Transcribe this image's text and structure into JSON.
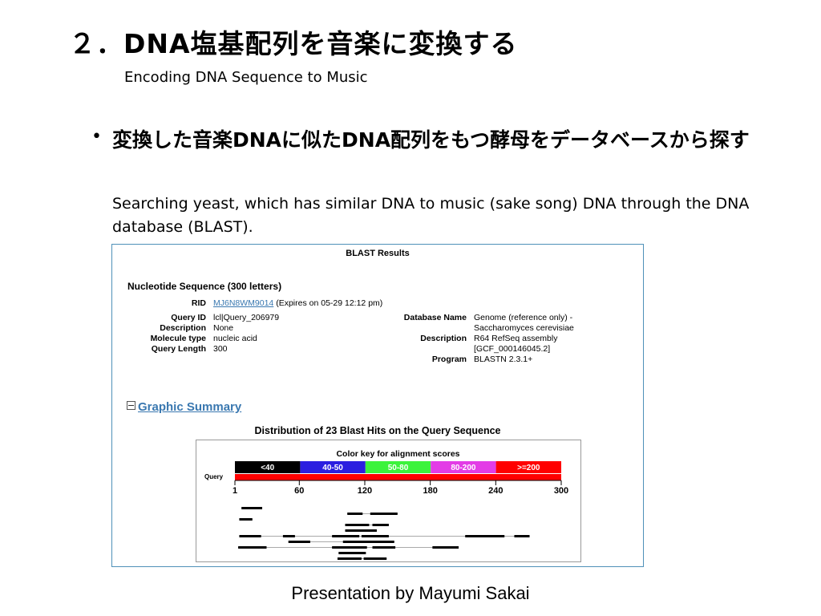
{
  "slide": {
    "title": "２．DNA塩基配列を音楽に変換する",
    "subtitle": "Encoding DNA Sequence to Music",
    "bullet_text": "変換した音楽DNAに似たDNA配列をもつ酵母をデータベースから探す",
    "bullet_sub": "Searching yeast, which has similar DNA to music (sake song) DNA through the DNA database (BLAST).",
    "footer": "Presentation by Mayumi Sakai"
  },
  "blast": {
    "header": "BLAST Results",
    "nucleotide_title": "Nucleotide Sequence (300 letters)",
    "rid_label": "RID",
    "rid_value": "MJ6N8WM9014",
    "rid_expiry": "(Expires on 05-29 12:12 pm)",
    "query_id_label": "Query ID",
    "query_id": "lcl|Query_206979",
    "description_label": "Description",
    "description": "None",
    "molecule_type_label": "Molecule type",
    "molecule_type": "nucleic acid",
    "query_length_label": "Query Length",
    "query_length": "300",
    "database_name_label": "Database Name",
    "database_name_1": "Genome (reference only) -",
    "database_name_2": "Saccharomyces cerevisiae",
    "db_description_label": "Description",
    "db_description_1": "R64 RefSeq assembly",
    "db_description_2": "[GCF_000146045.2]",
    "program_label": "Program",
    "program": "BLASTN 2.3.1+",
    "graphic_summary": "Graphic Summary",
    "distribution_title": "Distribution of 23 Blast Hits on the Query Sequence",
    "color_key_title": "Color key for alignment scores",
    "query_label": "Query",
    "score_bins": [
      {
        "label": "<40",
        "color": "#000000"
      },
      {
        "label": "40-50",
        "color": "#2b1fe0"
      },
      {
        "label": "50-80",
        "color": "#3cf33c"
      },
      {
        "label": "80-200",
        "color": "#e33ce6"
      },
      {
        "label": ">=200",
        "color": "#ff0000"
      }
    ],
    "query_bar_color": "#ff0000",
    "axis_ticks": [
      "1",
      "60",
      "120",
      "180",
      "240",
      "300"
    ],
    "hits": [
      {
        "segments": [
          [
            7,
            26
          ]
        ]
      },
      {
        "segments": [
          [
            104,
            118
          ],
          [
            125,
            150
          ]
        ]
      },
      {
        "segments": [
          [
            5,
            17
          ]
        ]
      },
      {
        "segments": [
          [
            102,
            124
          ],
          [
            127,
            142
          ]
        ]
      },
      {
        "segments": [
          [
            102,
            131
          ]
        ]
      },
      {
        "segments": [
          [
            5,
            25
          ],
          [
            45,
            56
          ],
          [
            90,
            115
          ],
          [
            117,
            142
          ],
          [
            212,
            248
          ],
          [
            257,
            271
          ]
        ]
      },
      {
        "segments": [
          [
            50,
            70
          ],
          [
            100,
            128
          ],
          [
            127,
            147
          ]
        ]
      },
      {
        "segments": [
          [
            4,
            30
          ],
          [
            90,
            122
          ],
          [
            127,
            148
          ],
          [
            182,
            206
          ]
        ]
      },
      {
        "segments": [
          [
            96,
            121
          ]
        ]
      },
      {
        "segments": [
          [
            95,
            117
          ],
          [
            119,
            140
          ]
        ]
      }
    ]
  }
}
